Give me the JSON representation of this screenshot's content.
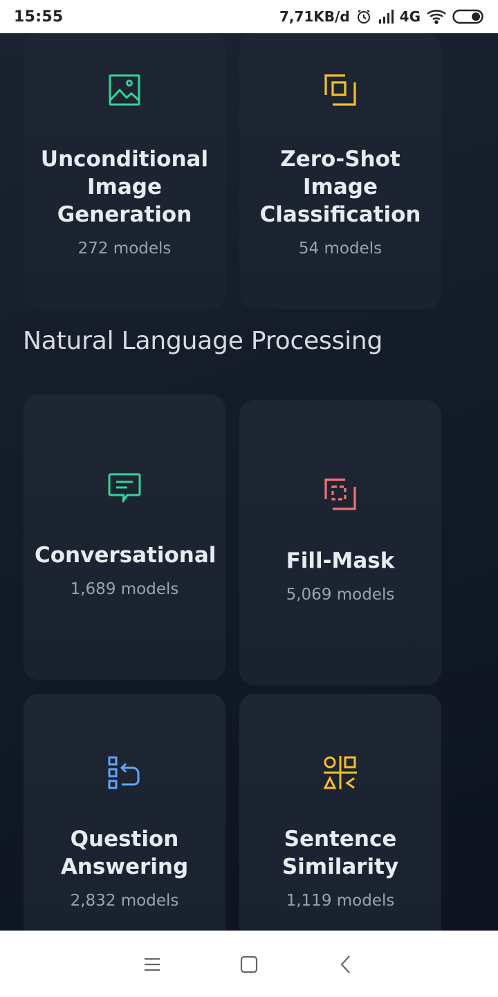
{
  "status_bar": {
    "time": "15:55",
    "network_speed": "7,71KB/d",
    "network_type": "4G"
  },
  "cards_top": [
    {
      "title": "Unconditional Image Generation",
      "count": "272 models",
      "icon": "image-icon",
      "color": "#34d399"
    },
    {
      "title": "Zero-Shot Image Classification",
      "count": "54 models",
      "icon": "image-classification-icon",
      "color": "#fbbf24"
    }
  ],
  "section": {
    "heading": "Natural Language Processing"
  },
  "cards_nlp": [
    {
      "title": "Conversational",
      "count": "1,689 models",
      "icon": "chat-icon",
      "color": "#34d399"
    },
    {
      "title": "Fill-Mask",
      "count": "5,069 models",
      "icon": "fill-mask-icon",
      "color": "#f87171"
    },
    {
      "title": "Question Answering",
      "count": "2,832 models",
      "icon": "question-answering-icon",
      "color": "#60a5fa"
    },
    {
      "title": "Sentence Similarity",
      "count": "1,119 models",
      "icon": "sentence-similarity-icon",
      "color": "#fbbf24"
    }
  ],
  "nav_bar": {
    "items": [
      "menu-icon",
      "home-icon",
      "back-icon"
    ]
  }
}
